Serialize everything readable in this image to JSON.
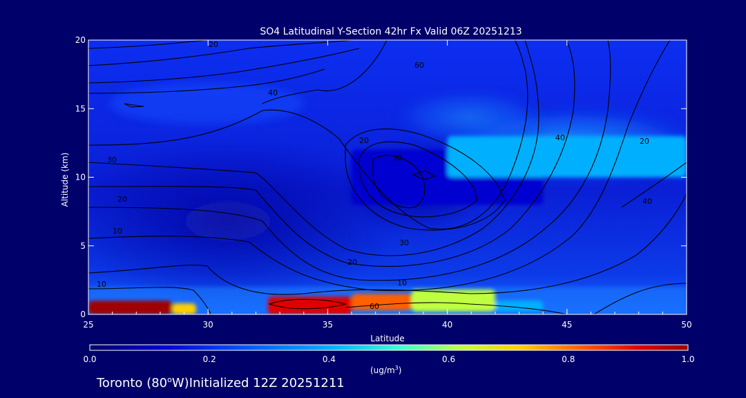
{
  "chart_data": {
    "type": "heatmap",
    "title": "SO4 Latitudinal Y-Section 42hr  Fx Valid 06Z 20251213",
    "xlabel": "Latitude",
    "ylabel": "Altitude (km)",
    "xlim": [
      25,
      50
    ],
    "ylim": [
      0,
      20
    ],
    "x_ticks": [
      "25",
      "30",
      "35",
      "40",
      "45",
      "50"
    ],
    "y_ticks": [
      "0",
      "5",
      "10",
      "15",
      "20"
    ],
    "colorbar": {
      "ticks": [
        "0.0",
        "0.2",
        "0.4",
        "0.6",
        "0.8",
        "1.0"
      ],
      "range": [
        0,
        1
      ],
      "unit_main": "(ug/m",
      "unit_sup": "3",
      "unit_end": ")",
      "colors": [
        "#00006a",
        "#0000d0",
        "#0050ff",
        "#00b0ff",
        "#40ffd0",
        "#c0ff40",
        "#ffd000",
        "#ff6000",
        "#e00000",
        "#a00000"
      ]
    },
    "heat_regions": [
      {
        "lat": [
          25,
          28.5
        ],
        "alt": [
          0,
          1.0
        ],
        "value": 1.0
      },
      {
        "lat": [
          28.5,
          29.5
        ],
        "alt": [
          0,
          0.8
        ],
        "value": 0.7
      },
      {
        "lat": [
          32.5,
          36
        ],
        "alt": [
          0,
          1.3
        ],
        "value": 0.9
      },
      {
        "lat": [
          36,
          38.5
        ],
        "alt": [
          0.3,
          1.5
        ],
        "value": 0.75
      },
      {
        "lat": [
          38.5,
          42
        ],
        "alt": [
          0.2,
          1.8
        ],
        "value": 0.55
      },
      {
        "lat": [
          42,
          44
        ],
        "alt": [
          0.2,
          1.0
        ],
        "value": 0.3
      },
      {
        "lat": [
          36,
          44
        ],
        "alt": [
          8,
          12
        ],
        "value": 0.15
      },
      {
        "lat": [
          40,
          50
        ],
        "alt": [
          10,
          13
        ],
        "value": 0.3
      }
    ],
    "contour_labels": [
      "20",
      "60",
      "40",
      "30",
      "20",
      "10",
      "10",
      "20",
      "30",
      "40",
      "30",
      "20",
      "10",
      "60",
      "40",
      "20"
    ],
    "footer": {
      "location": "Toronto",
      "longitude": "(80",
      "degree": "o",
      "lon_suffix": "W)",
      "init": "Initialized 12Z 20251211"
    }
  }
}
